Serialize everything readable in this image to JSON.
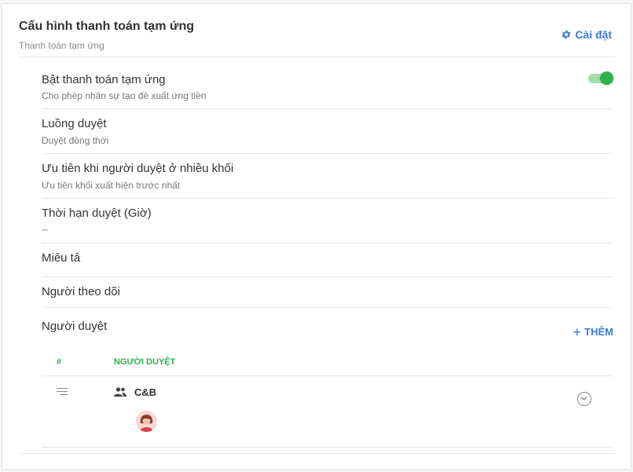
{
  "header": {
    "title": "Cấu hình thanh toán tạm ứng",
    "subtitle": "Thanh toán tạm ứng",
    "settings_label": "Cài đặt"
  },
  "settings": {
    "enable": {
      "label": "Bật thanh toán tạm ứng",
      "description": "Cho phép nhân sự tạo đề xuất ứng tiền",
      "enabled": true
    },
    "flow": {
      "label": "Luồng duyệt",
      "value": "Duyệt đồng thời"
    },
    "priority": {
      "label": "Ưu tiên khi người duyệt ở nhiều khối",
      "value": "Ưu tiên khối xuất hiện trước nhất"
    },
    "deadline": {
      "label": "Thời hạn duyệt (Giờ)",
      "value": "--"
    },
    "description": {
      "label": "Miêu tả"
    },
    "followers": {
      "label": "Người theo dõi"
    }
  },
  "approvers": {
    "label": "Người duyệt",
    "add_label": "THÊM",
    "columns": [
      "#",
      "NGƯỜI DUYỆT"
    ],
    "rows": [
      {
        "group_name": "C&B",
        "group_icon": "group-icon",
        "avatar_count": 1
      }
    ]
  },
  "colors": {
    "accent_blue": "#3a7bd5",
    "accent_green": "#2bb24c"
  }
}
